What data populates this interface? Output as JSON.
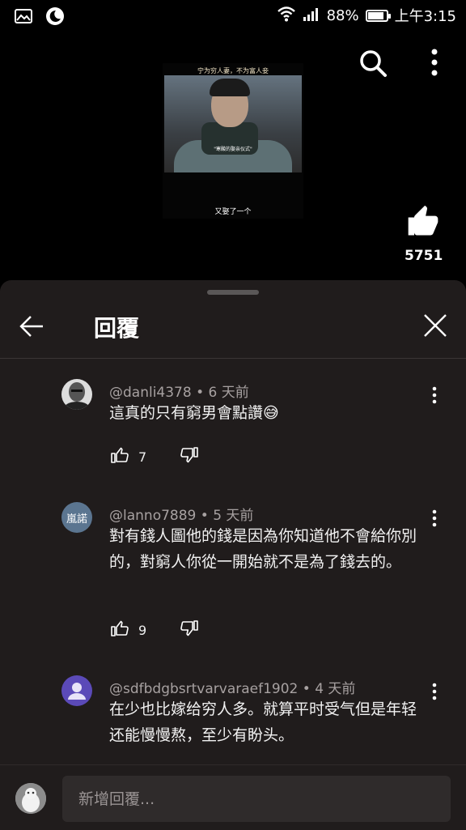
{
  "status_bar": {
    "battery": "88%",
    "time": "上午3:15",
    "battery_level": 0.88,
    "icons": [
      "gallery-icon",
      "moon-icon",
      "wifi-icon",
      "signal-icon",
      "battery-icon"
    ]
  },
  "video": {
    "thumb_top": "宁为穷人妻，不为富人妾",
    "thumb_caption": "\"寒酸的娶亲仪式\"",
    "thumb_bottom": "又娶了一个",
    "like_count": "5751"
  },
  "sheet": {
    "title": "回覆"
  },
  "comments": [
    {
      "meta": "@danli4378 • 6 天前",
      "text": "這真的只有窮男會點讚😅",
      "likes": "7"
    },
    {
      "meta": "@lanno7889 • 5 天前",
      "avatar_text": "嵐諾",
      "text": "對有錢人圖他的錢是因為你知道他不會給你別的，對窮人你從一開始就不是為了錢去的。",
      "likes": "9"
    },
    {
      "meta": "@sdfbdgbsrtvarvaraef1902 • 4 天前",
      "text": "在少也比嫁给穷人多。就算平时受气但是年轻还能慢慢熬，至少有盼头。"
    }
  ],
  "reply_input": {
    "placeholder": "新增回覆..."
  },
  "colors": {
    "sheet_bg": "#201c1c",
    "avatar_blue": "#5b7590",
    "avatar_purple": "#5b4ab8"
  }
}
